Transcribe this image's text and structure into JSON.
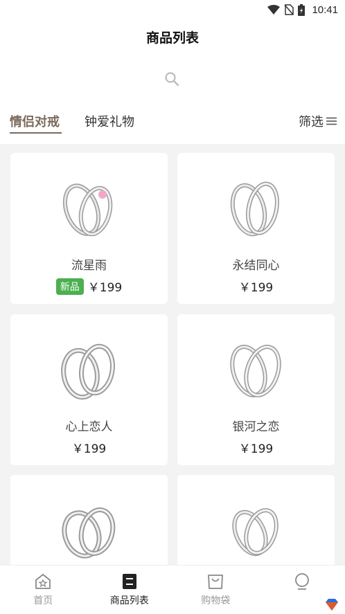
{
  "status_bar": {
    "time": "10:41"
  },
  "header": {
    "title": "商品列表"
  },
  "tabs": [
    {
      "label": "情侣对戒",
      "active": true
    },
    {
      "label": "钟爱礼物",
      "active": false
    }
  ],
  "filter": {
    "label": "筛选"
  },
  "products": [
    {
      "name": "流星雨",
      "price": "￥199",
      "badge": "新品"
    },
    {
      "name": "永结同心",
      "price": "￥199"
    },
    {
      "name": "心上恋人",
      "price": "￥199"
    },
    {
      "name": "银河之恋",
      "price": "￥199"
    },
    {
      "name": "",
      "price": ""
    },
    {
      "name": "",
      "price": ""
    }
  ],
  "bottom_nav": [
    {
      "label": "首页",
      "icon": "home-icon"
    },
    {
      "label": "商品列表",
      "icon": "list-icon",
      "active": true
    },
    {
      "label": "购物袋",
      "icon": "bag-icon"
    },
    {
      "label": "",
      "icon": "profile-icon"
    }
  ],
  "colors": {
    "accent": "#7b6a5c",
    "badge": "#4caf50",
    "grid_bg": "#f3f3f3"
  }
}
